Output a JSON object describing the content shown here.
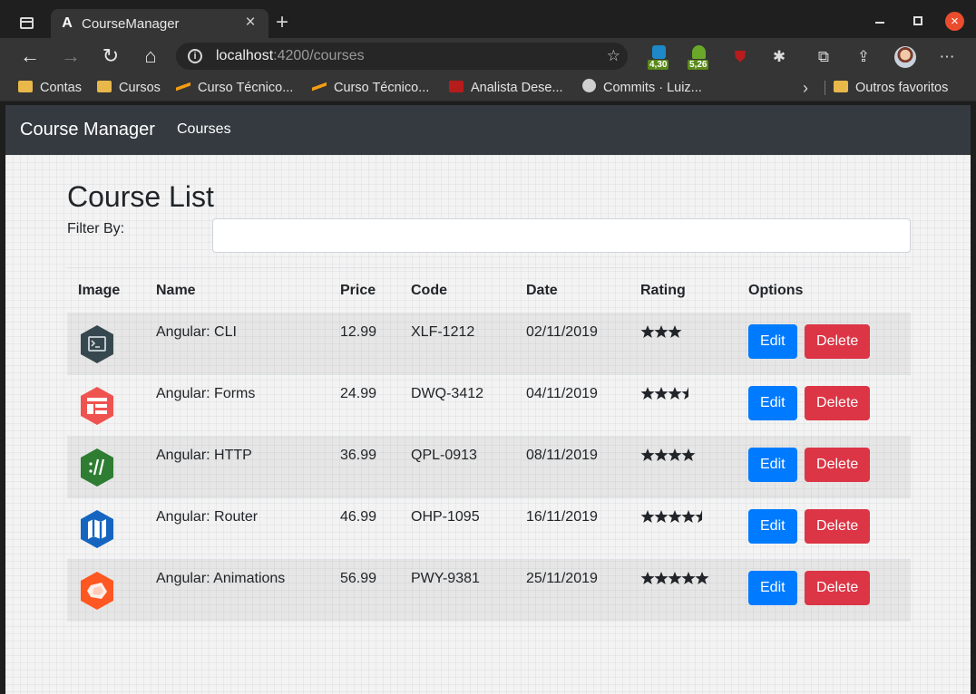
{
  "browser": {
    "tab_title": "CourseManager",
    "url_host": "localhost",
    "url_path": ":4200/courses",
    "extensions": [
      {
        "badge": "4,30",
        "color": "#1e88c8"
      },
      {
        "badge": "5,26",
        "color": "#6aa82a"
      }
    ],
    "bookmarks": [
      {
        "label": "Contas",
        "icon": "folder-icon"
      },
      {
        "label": "Cursos",
        "icon": "folder-icon"
      },
      {
        "label": "Curso Técnico...",
        "icon": "course-site-icon"
      },
      {
        "label": "Curso Técnico...",
        "icon": "course-site-icon"
      },
      {
        "label": "Analista Dese...",
        "icon": "job-site-icon"
      },
      {
        "label": "Commits · Luiz...",
        "icon": "github-icon"
      }
    ],
    "other_bookmarks": "Outros favoritos"
  },
  "navbar": {
    "brand": "Course Manager",
    "link": "Courses"
  },
  "page": {
    "title": "Course List",
    "filter_label": "Filter By:",
    "filter_value": ""
  },
  "table": {
    "headers": [
      "Image",
      "Name",
      "Price",
      "Code",
      "Date",
      "Rating",
      "Options"
    ],
    "edit_label": "Edit",
    "delete_label": "Delete",
    "rows": [
      {
        "name": "Angular: CLI",
        "price": "12.99",
        "code": "XLF-1212",
        "date": "02/11/2019",
        "rating": 3,
        "icon": "cli-icon",
        "icon_color": "#37474f"
      },
      {
        "name": "Angular: Forms",
        "price": "24.99",
        "code": "DWQ-3412",
        "date": "04/11/2019",
        "rating": 3.5,
        "icon": "forms-icon",
        "icon_color": "#ef5350"
      },
      {
        "name": "Angular: HTTP",
        "price": "36.99",
        "code": "QPL-0913",
        "date": "08/11/2019",
        "rating": 4,
        "icon": "http-icon",
        "icon_color": "#2e7d32"
      },
      {
        "name": "Angular: Router",
        "price": "46.99",
        "code": "OHP-1095",
        "date": "16/11/2019",
        "rating": 4.5,
        "icon": "router-icon",
        "icon_color": "#1565c0"
      },
      {
        "name": "Angular: Animations",
        "price": "56.99",
        "code": "PWY-9381",
        "date": "25/11/2019",
        "rating": 5,
        "icon": "animations-icon",
        "icon_color": "#ff5722"
      }
    ]
  }
}
